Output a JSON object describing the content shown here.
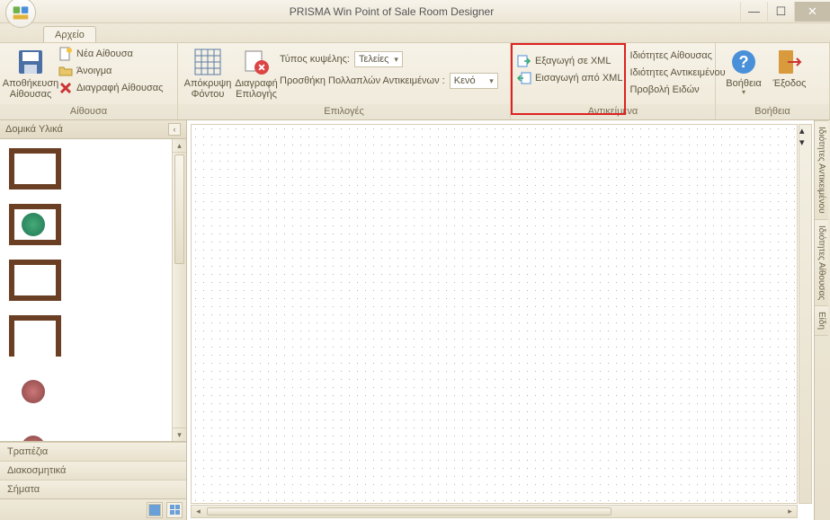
{
  "window": {
    "title": "PRISMA Win Point of Sale Room Designer"
  },
  "tabs": {
    "file": "Αρχείο"
  },
  "ribbon": {
    "group_room": {
      "save_room": "Αποθήκευση\nΑίθουσας",
      "new_room": "Νέα Αίθουσα",
      "open": "Άνοιγμα",
      "delete_room": "Διαγραφή Αίθουσας",
      "label": "Αίθουσα"
    },
    "group_options": {
      "hide_bg": "Απόκρυψη\nΦόντου",
      "delete_sel": "Διαγραφή\nΕπιλογής",
      "cell_type_label": "Τύπος κυψέλης:",
      "cell_type_value": "Τελείες",
      "add_multi_label": "Προσθήκη Πολλαπλών Αντικειμένων :",
      "add_multi_value": "Κενό",
      "label": "Επιλογές"
    },
    "group_objects": {
      "export_xml": "Εξαγωγή σε XML",
      "import_xml": "Εισαγωγή από XML",
      "room_props": "Ιδιότητες Αίθουσας",
      "obj_props": "Ιδιότητες Αντικειμένου",
      "view_items": "Προβολή Ειδών",
      "label": "Αντικείμενα"
    },
    "group_help": {
      "help": "Βοήθεια",
      "exit": "Έξοδος",
      "label": "Βοήθεια"
    }
  },
  "leftpanel": {
    "header": "Δομικά Υλικά",
    "categories": [
      "Τραπέζια",
      "Διακοσμητικά",
      "Σήματα"
    ]
  },
  "rightpanel": {
    "tabs": [
      "Ιδιότητες Αντικειμένου",
      "Ιδιότητες Αίθουσας",
      "Είδη"
    ]
  }
}
